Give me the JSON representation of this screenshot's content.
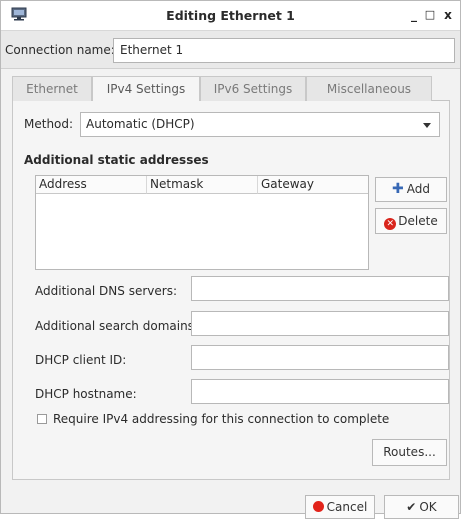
{
  "window": {
    "title": "Editing Ethernet 1",
    "minimize_glyph": "_",
    "maximize_glyph": "□",
    "close_glyph": "x"
  },
  "connection": {
    "label": "Connection name:",
    "value": "Ethernet 1"
  },
  "tabs": [
    {
      "label": "Ethernet",
      "active": false
    },
    {
      "label": "IPv4 Settings",
      "active": true
    },
    {
      "label": "IPv6 Settings",
      "active": false
    },
    {
      "label": "Miscellaneous",
      "active": false
    }
  ],
  "ipv4": {
    "method_label": "Method:",
    "method_value": "Automatic (DHCP)",
    "section_title": "Additional static addresses",
    "table_columns": [
      "Address",
      "Netmask",
      "Gateway"
    ],
    "add_label": "Add",
    "delete_label": "Delete",
    "fields": [
      {
        "label": "Additional DNS servers:",
        "value": ""
      },
      {
        "label": "Additional search domains:",
        "value": ""
      },
      {
        "label": "DHCP client ID:",
        "value": ""
      },
      {
        "label": "DHCP hostname:",
        "value": ""
      }
    ],
    "require_label": "Require IPv4 addressing for this connection to complete",
    "require_checked": false,
    "routes_label": "Routes..."
  },
  "footer": {
    "cancel_label": "Cancel",
    "ok_label": "OK"
  },
  "colors": {
    "add_icon": "#3768b5",
    "delete_icon": "#d9251c",
    "cancel_icon": "#e2231a"
  }
}
